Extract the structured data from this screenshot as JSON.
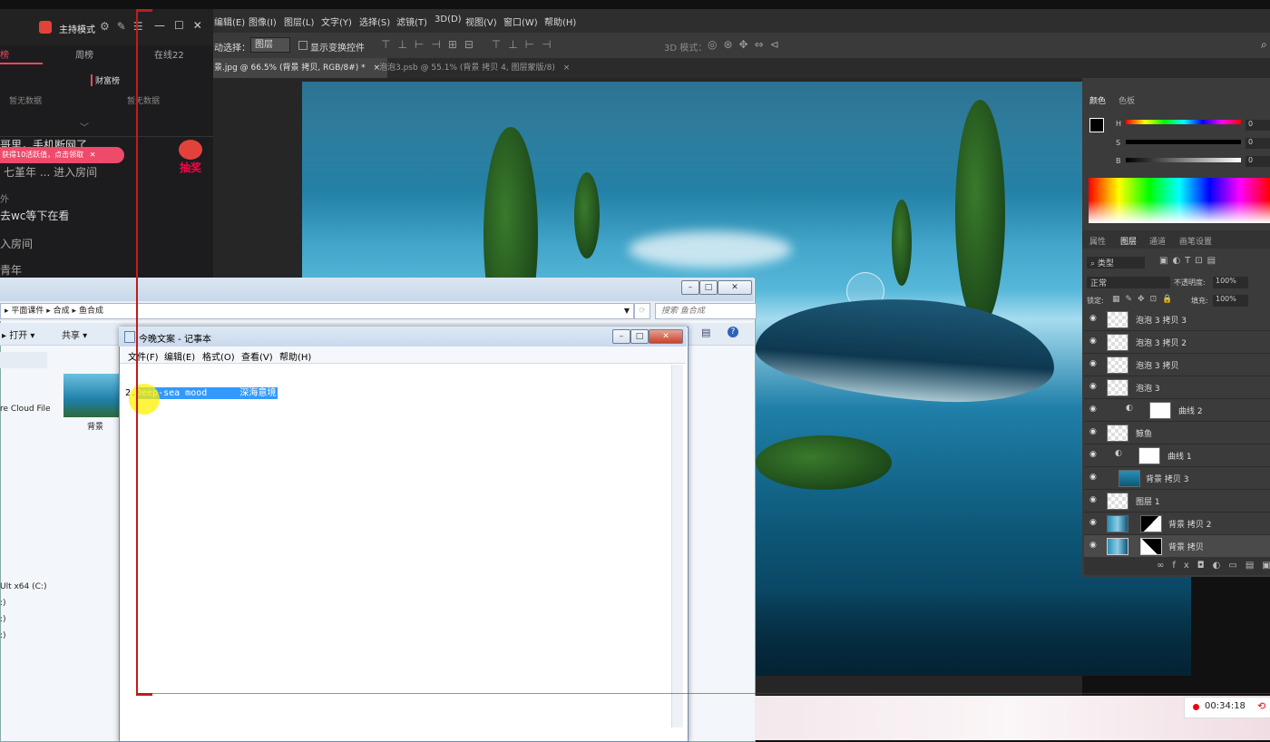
{
  "photoshop": {
    "menu": [
      "编辑(E)",
      "图像(I)",
      "图层(L)",
      "文字(Y)",
      "选择(S)",
      "滤镜(T)",
      "3D(D)",
      "视图(V)",
      "窗口(W)",
      "帮助(H)"
    ],
    "options": {
      "auto_select_label": "动选择：",
      "auto_select_value": "图层",
      "show_transform": "显示变换控件",
      "mode_3d": "3D 模式："
    },
    "tabs": [
      {
        "label": "景.jpg @ 66.5% (背景 拷贝, RGB/8#) *",
        "active": true
      },
      {
        "label": "泡泡3.psb @ 55.1% (背景 拷贝 4, 图层蒙版/8)",
        "active": false
      }
    ],
    "color_panel": {
      "tabs": [
        "颜色",
        "色板"
      ],
      "channels": [
        {
          "label": "H",
          "value": "0"
        },
        {
          "label": "S",
          "value": "0"
        },
        {
          "label": "B",
          "value": "0"
        }
      ]
    },
    "layers_panel": {
      "tabs": [
        "属性",
        "图层",
        "通道",
        "画笔设置"
      ],
      "filter_label": "类型",
      "blend_mode": "正常",
      "opacity_label": "不透明度:",
      "opacity_value": "100%",
      "lock_label": "锁定:",
      "fill_label": "填充:",
      "fill_value": "100%",
      "layers": [
        {
          "name": "泡泡 3 拷贝 3",
          "selected": false
        },
        {
          "name": "泡泡 3 拷贝 2",
          "selected": false
        },
        {
          "name": "泡泡 3 拷贝",
          "selected": false
        },
        {
          "name": "泡泡 3",
          "selected": false
        },
        {
          "name": "曲线 2",
          "selected": false
        },
        {
          "name": "鲸鱼",
          "selected": false
        },
        {
          "name": "曲线 1",
          "selected": false
        },
        {
          "name": "背景 拷贝 3",
          "selected": false
        },
        {
          "name": "图层 1",
          "selected": false
        },
        {
          "name": "背景 拷贝 2",
          "selected": false
        },
        {
          "name": "背景 拷贝",
          "selected": true
        }
      ]
    }
  },
  "live": {
    "mode": "主持模式",
    "tabs": [
      "榜",
      "周榜",
      "在线22"
    ],
    "rank_title": "财富榜",
    "no_data_1": "暂无数据",
    "no_data_2": "暂无数据",
    "chat": [
      "哥里，手机断网了",
      "七堇年 ... 进入房间",
      "外",
      "去wc等下在看",
      "入房间",
      "青年"
    ],
    "reward_banner": "获得10活跃值，点击领取",
    "lottery": "抽奖"
  },
  "explorer": {
    "breadcrumb": [
      "平面课件",
      "合成",
      "鱼合成"
    ],
    "search_placeholder": "搜索 鱼合成",
    "toolbar": [
      "打开",
      "共享"
    ],
    "file_label": "背景",
    "sidebar": [
      "re Cloud File",
      "Ult x64 (C:)",
      ":)",
      ":)",
      ":)"
    ]
  },
  "notepad": {
    "title": "今晚文案 - 记事本",
    "menu": [
      "文件(F)",
      "编辑(E)",
      "格式(O)",
      "查看(V)",
      "帮助(H)"
    ],
    "line_prefix": "2.",
    "selected_text": "Deep-sea mood",
    "selected_text_cn": "深海意境"
  },
  "recorder": {
    "time": "00:34:18"
  },
  "colors": {
    "accent_red": "#c21b1b",
    "selection_blue": "#3399ff",
    "ps_panel": "#3b3b3b"
  }
}
